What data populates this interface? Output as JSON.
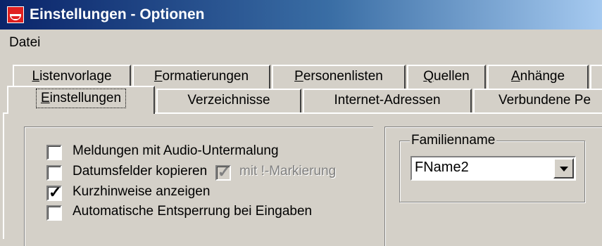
{
  "window": {
    "title": "Einstellungen - Optionen",
    "icon": "app-flag-icon"
  },
  "menu": {
    "items": [
      {
        "label": "Datei"
      }
    ]
  },
  "tabs": {
    "row1": [
      {
        "label": "Listenvorlage",
        "mnemonic": "L"
      },
      {
        "label": "Formatierungen",
        "mnemonic": "F"
      },
      {
        "label": "Personenlisten",
        "mnemonic": "P"
      },
      {
        "label": "Quellen",
        "mnemonic": "Q"
      },
      {
        "label": "Anhänge",
        "mnemonic": "A"
      }
    ],
    "row2": [
      {
        "label": "Einstellungen",
        "mnemonic": "E",
        "active": true
      },
      {
        "label": "Verzeichnisse"
      },
      {
        "label": "Internet-Adressen"
      },
      {
        "label": "Verbundene Pe"
      }
    ]
  },
  "options": {
    "audio": {
      "label": "Meldungen mit Audio-Untermalung",
      "checked": false
    },
    "datum": {
      "label": "Datumsfelder kopieren",
      "checked": false,
      "sub_label": "mit !-Markierung",
      "sub_checked": true,
      "sub_disabled": true
    },
    "kurzhinweise": {
      "label": "Kurzhinweise anzeigen",
      "checked": true
    },
    "entsperrung": {
      "label": "Automatische Entsperrung bei Eingaben",
      "checked": false
    }
  },
  "familienname": {
    "legend": "Familienname",
    "selected": "FName2"
  },
  "colors": {
    "face": "#d4d0c8",
    "title_start": "#0a246a",
    "title_end": "#a6caf0"
  }
}
